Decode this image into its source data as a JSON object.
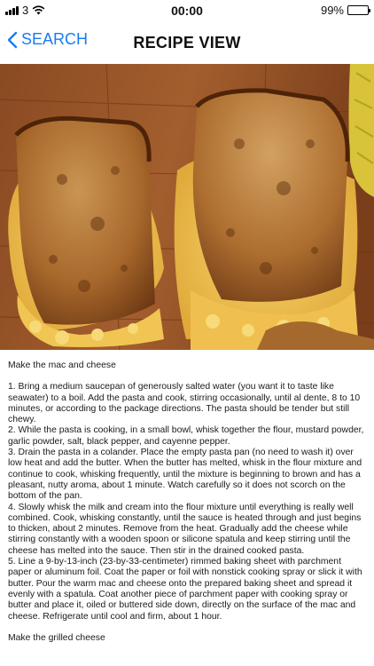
{
  "status_bar": {
    "carrier": "3",
    "time": "00:00",
    "battery": "99%",
    "battery_level": 0.99
  },
  "nav": {
    "back_label": "SEARCH",
    "title": "RECIPE VIEW"
  },
  "colors": {
    "accent": "#1a7cf0",
    "background": "#ffffff"
  },
  "icons": [
    "signal-icon",
    "wifi-icon",
    "battery-icon",
    "chevron-left-icon"
  ],
  "recipe": {
    "section1_title": "Make the mac and cheese",
    "steps": [
      "1. Bring a medium saucepan of generously salted water (you want it to taste like seawater) to a boil. Add the pasta and cook, stirring occasionally, until al dente, 8 to 10 minutes, or according to the package directions. The pasta should be tender but still chewy.",
      "2. While the pasta is cooking, in a small bowl, whisk together the flour, mustard powder, garlic powder, salt, black pepper, and cayenne pepper.",
      "3. Drain the pasta in a colander. Place the empty pasta pan (no need to wash it) over low heat and add the butter. When the butter has melted, whisk in the flour mixture and continue to cook, whisking frequently, until the mixture is beginning to brown and has a pleasant, nutty aroma, about 1 minute. Watch carefully so it does not scorch on the bottom of the pan.",
      "4. Slowly whisk the milk and cream into the flour mixture until everything is really well combined. Cook, whisking constantly, until the sauce is heated through and just begins to thicken, about 2 minutes. Remove from the heat. Gradually add the cheese while stirring constantly with a wooden spoon or silicone spatula and keep stirring until the cheese has melted into the sauce. Then stir in the drained cooked pasta.",
      "5. Line a 9-by-13-inch (23-by-33-centimeter) rimmed baking sheet with parchment paper or aluminum foil. Coat the paper or foil with nonstick cooking spray or slick it with butter. Pour the warm mac and cheese onto the prepared baking sheet and spread it evenly with a spatula. Coat another piece of parchment paper with cooking spray or butter and place it, oiled or buttered side down, directly on the surface of the mac and cheese. Refrigerate until cool and firm, about 1 hour."
    ],
    "section2_title": "Make the grilled cheese"
  }
}
